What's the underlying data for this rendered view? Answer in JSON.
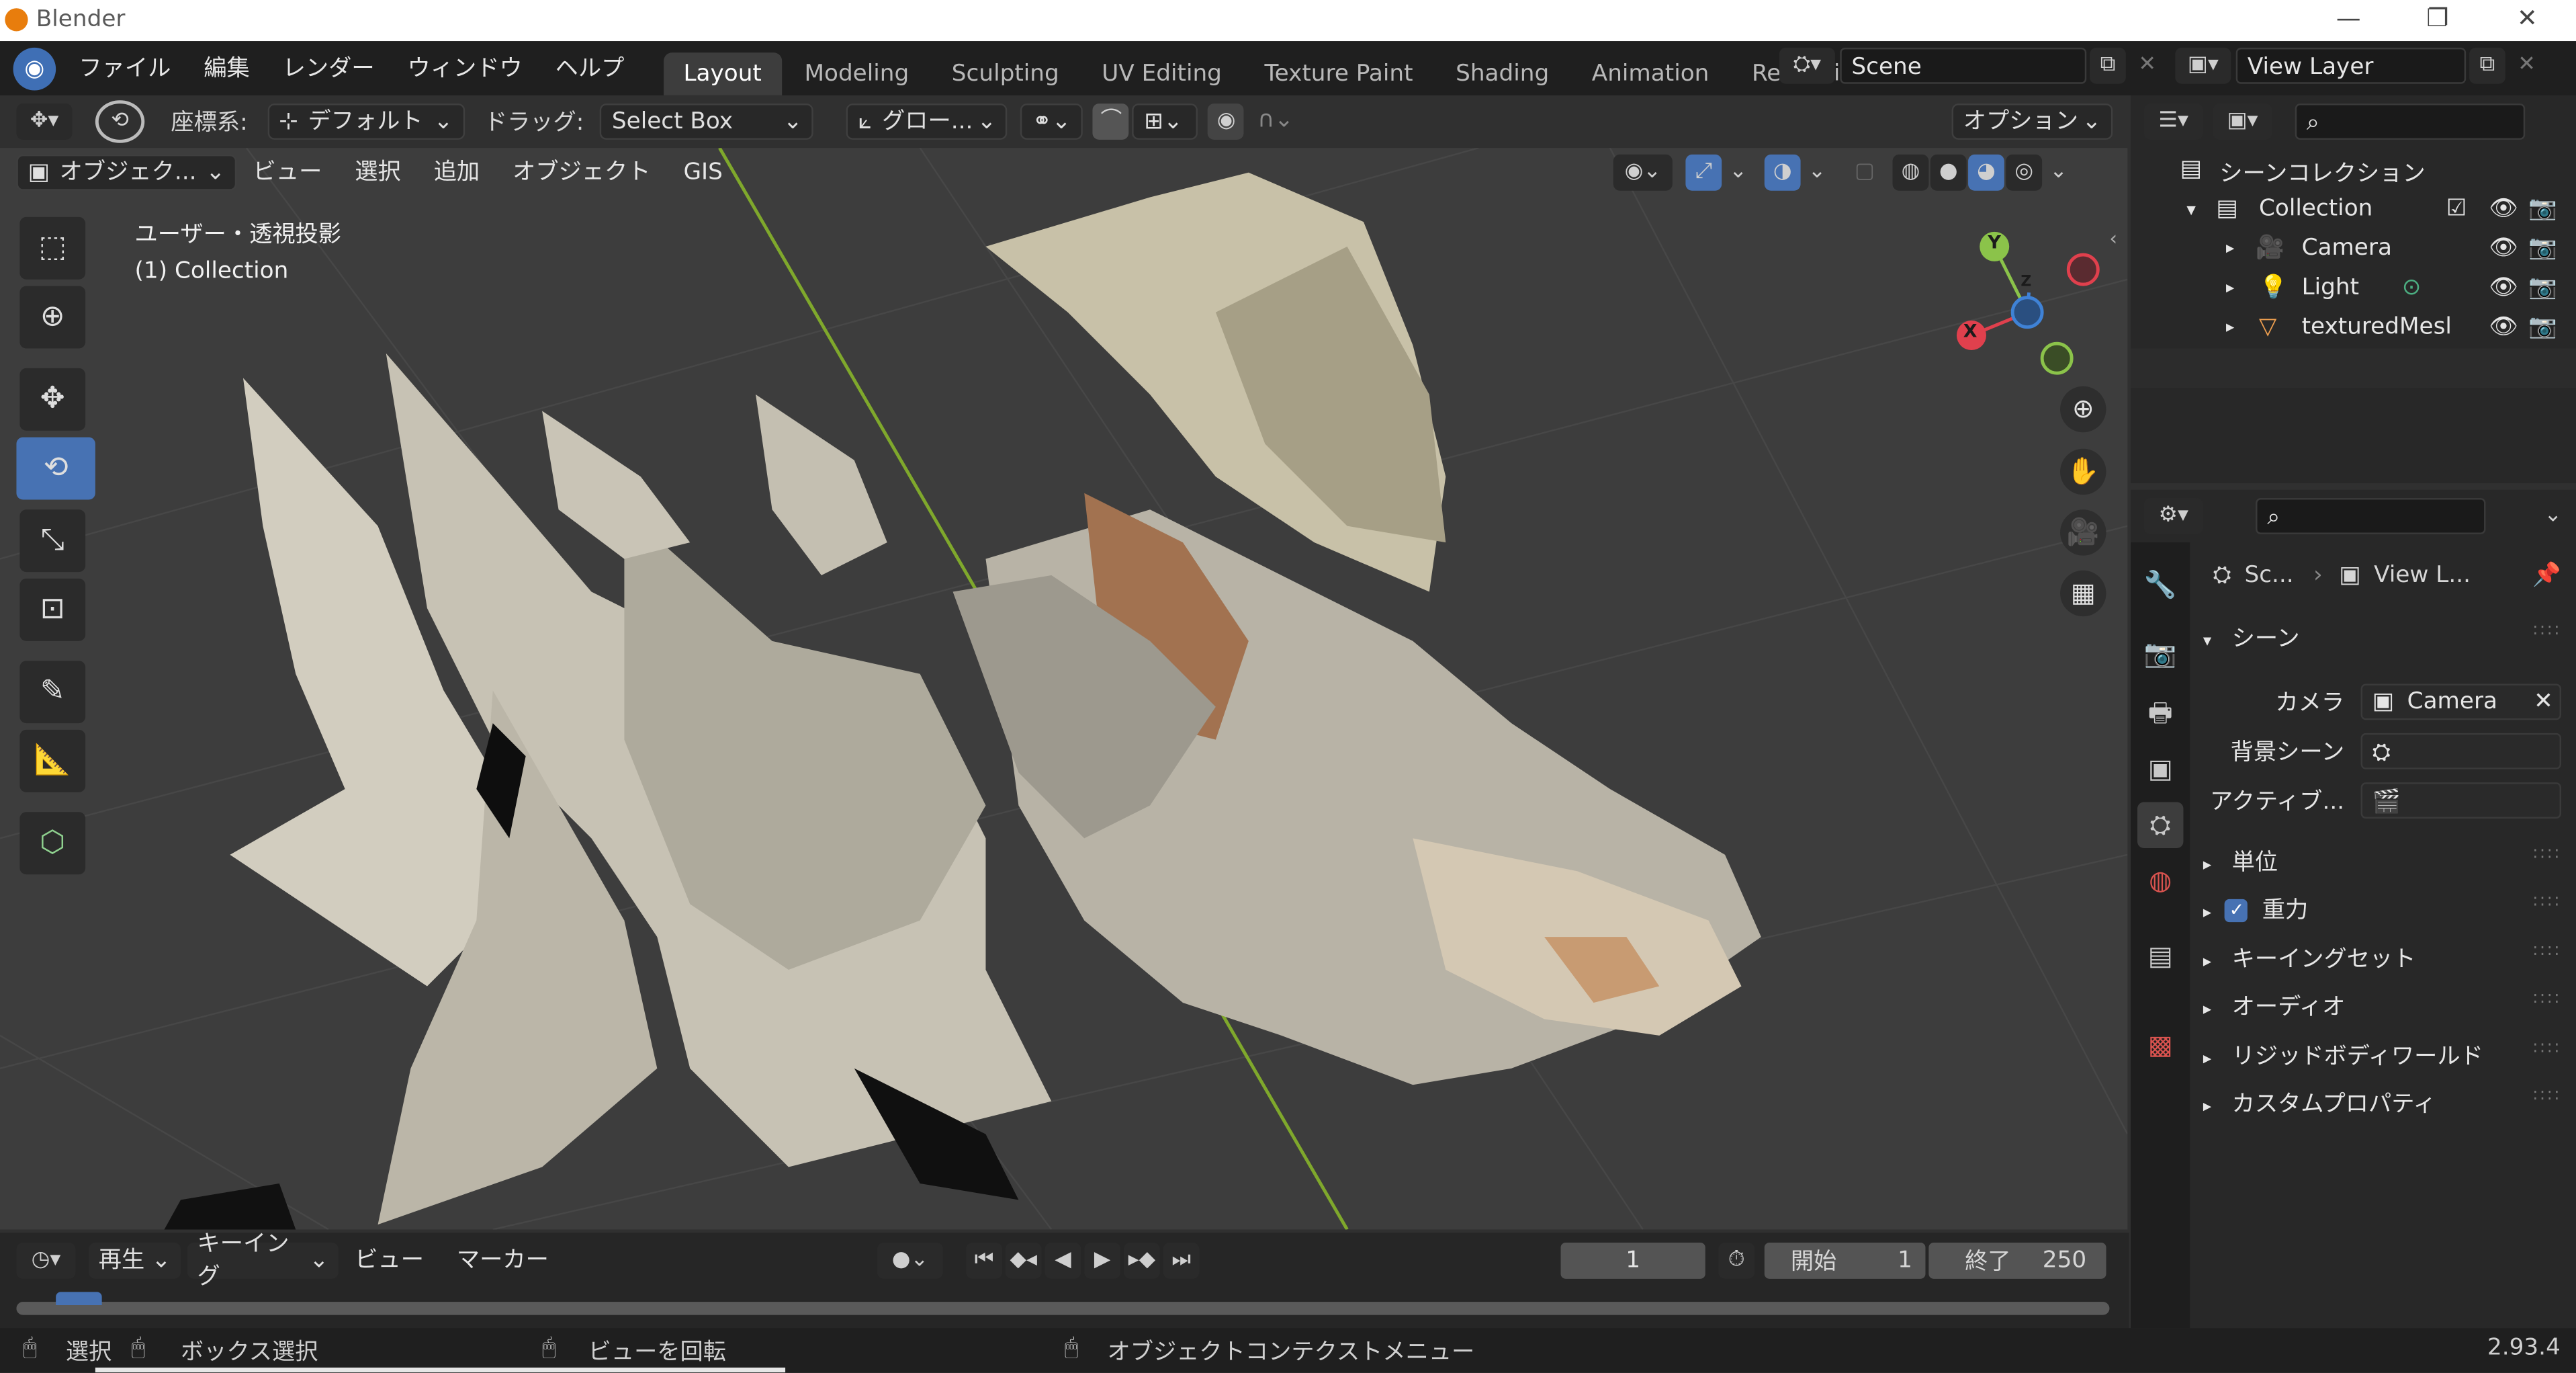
{
  "titlebar": {
    "title": "Blender"
  },
  "menu": [
    "ファイル",
    "編集",
    "レンダー",
    "ウィンドウ",
    "ヘルプ"
  ],
  "workspaces": [
    "Layout",
    "Modeling",
    "Sculpting",
    "UV Editing",
    "Texture Paint",
    "Shading",
    "Animation",
    "Renderinc"
  ],
  "scene": {
    "value": "Scene"
  },
  "view_layer": {
    "value": "View Layer"
  },
  "tool_settings": {
    "coord_label": "座標系:",
    "coord_value": "デフォルト",
    "drag_label": "ドラッグ:",
    "drag_value": "Select Box",
    "orientation": "グロー...",
    "options": "オプション"
  },
  "viewport_header": {
    "mode": "オブジェク...",
    "view": "ビュー",
    "select": "選択",
    "add": "追加",
    "object": "オブジェクト",
    "gis": "GIS"
  },
  "viewport": {
    "view_name": "ユーザー・透視投影",
    "collection_label": "(1) Collection"
  },
  "gizmo": {
    "x": "X",
    "y": "Y",
    "z": "Z"
  },
  "outliner": {
    "root": "シーンコレクション",
    "collection": "Collection",
    "items": [
      "Camera",
      "Light",
      "texturedMesl"
    ]
  },
  "properties": {
    "crumb_scene": "Sc...",
    "crumb_layer": "View L...",
    "section": "シーン",
    "camera_label": "カメラ",
    "camera_value": "Camera",
    "background_label": "背景シーン",
    "active_label": "アクティブ...",
    "panels": [
      "単位",
      "重力",
      "キーイングセット",
      "オーディオ",
      "リジッドボディワールド",
      "カスタムプロパティ"
    ]
  },
  "timeline": {
    "play": "再生",
    "keying": "キーイング",
    "view": "ビュー",
    "marker": "マーカー",
    "current_frame": "1",
    "start_label": "開始",
    "start_value": "1",
    "end_label": "終了",
    "end_value": "250"
  },
  "status": {
    "select": "選択",
    "box_select": "ボックス選択",
    "rotate": "ビューを回転",
    "context_menu": "オブジェクトコンテクストメニュー",
    "version": "2.93.4"
  }
}
